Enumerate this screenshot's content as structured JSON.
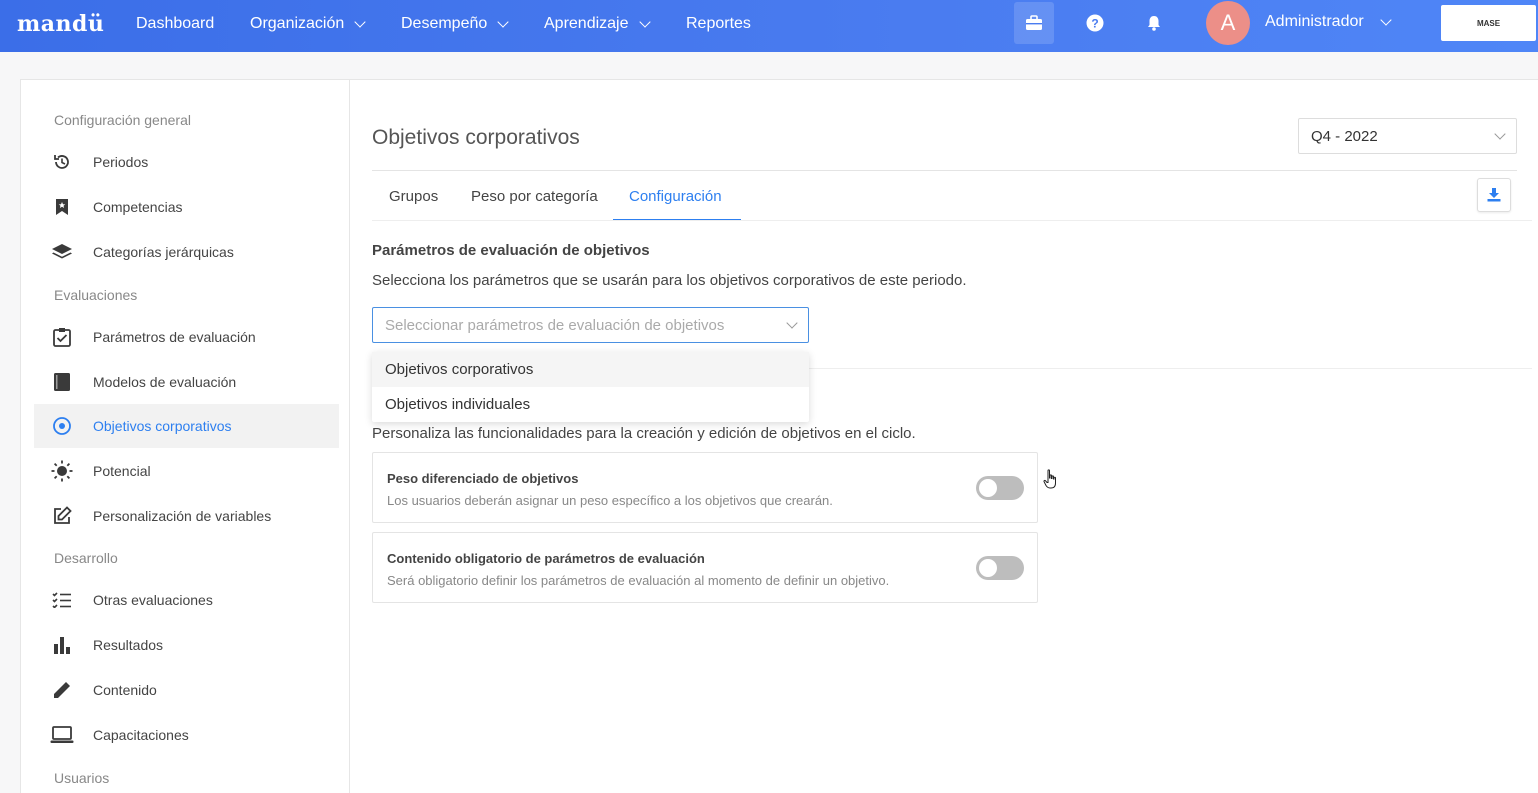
{
  "nav": {
    "logo": "mandü",
    "items": [
      {
        "label": "Dashboard",
        "dropdown": false
      },
      {
        "label": "Organización",
        "dropdown": true
      },
      {
        "label": "Desempeño",
        "dropdown": true
      },
      {
        "label": "Aprendizaje",
        "dropdown": true
      },
      {
        "label": "Reportes",
        "dropdown": false
      }
    ],
    "icons": [
      "briefcase-icon",
      "help-icon",
      "bell-icon"
    ],
    "avatar_initial": "A",
    "user_name": "Administrador",
    "company_logo_text": "MASE"
  },
  "sidebar": {
    "sections": [
      {
        "title": "Configuración general",
        "items": [
          {
            "label": "Periodos",
            "icon": "history-icon"
          },
          {
            "label": "Competencias",
            "icon": "bookmark-icon"
          },
          {
            "label": "Categorías jerárquicas",
            "icon": "layers-icon"
          }
        ]
      },
      {
        "title": "Evaluaciones",
        "items": [
          {
            "label": "Parámetros de evaluación",
            "icon": "checkbox-icon"
          },
          {
            "label": "Modelos de evaluación",
            "icon": "book-icon"
          },
          {
            "label": "Objetivos corporativos",
            "icon": "target-icon",
            "active": true
          },
          {
            "label": "Potencial",
            "icon": "sun-icon"
          },
          {
            "label": "Personalización de variables",
            "icon": "edit-icon"
          }
        ]
      },
      {
        "title": "Desarrollo",
        "items": [
          {
            "label": "Otras evaluaciones",
            "icon": "checklist-icon"
          },
          {
            "label": "Resultados",
            "icon": "bar-chart-icon"
          },
          {
            "label": "Contenido",
            "icon": "pencil-icon"
          },
          {
            "label": "Capacitaciones",
            "icon": "laptop-icon"
          }
        ]
      },
      {
        "title": "Usuarios",
        "items": []
      }
    ]
  },
  "main": {
    "title": "Objetivos corporativos",
    "period": "Q4 - 2022",
    "tabs": [
      {
        "label": "Grupos"
      },
      {
        "label": "Peso por categoría"
      },
      {
        "label": "Configuración",
        "active": true
      }
    ],
    "params_heading": "Parámetros de evaluación de objetivos",
    "params_desc": "Selecciona los parámetros que se usarán para los objetivos corporativos de este periodo.",
    "params_placeholder": "Seleccionar parámetros de evaluación de objetivos",
    "dropdown_options": [
      "Objetivos corporativos",
      "Objetivos individuales"
    ],
    "custom_desc": "Personaliza las funcionalidades para la creación y edición de objetivos en el ciclo.",
    "options": [
      {
        "title": "Peso diferenciado de objetivos",
        "desc": "Los usuarios deberán asignar un peso específico a los objetivos que crearán.",
        "enabled": false
      },
      {
        "title": "Contenido obligatorio de parámetros de evaluación",
        "desc": "Será obligatorio definir los parámetros de evaluación al momento de definir un objetivo.",
        "enabled": false
      }
    ]
  }
}
